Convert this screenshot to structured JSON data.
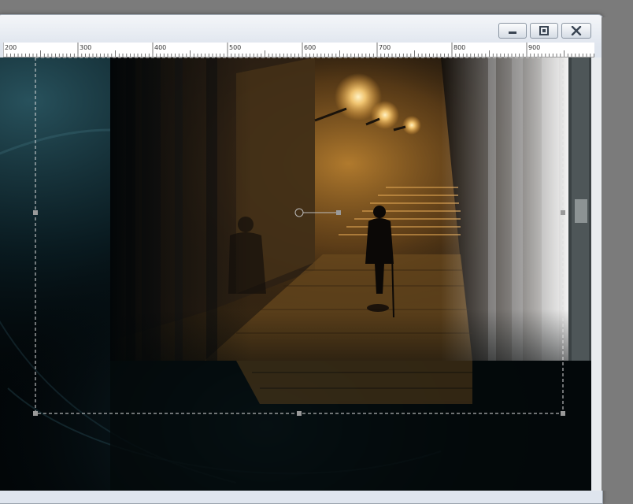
{
  "window": {
    "buttons": {
      "minimize": "minimize-icon",
      "maximize": "maximize-icon",
      "close": "close-icon"
    }
  },
  "ruler": {
    "labels": [
      "200",
      "300",
      "400",
      "500",
      "600",
      "700",
      "800",
      "900"
    ]
  },
  "colors": {
    "background": "#7b7b7b",
    "canvas": "#020608",
    "lamp_glow": "#ffd27a",
    "teal_swirl": "#2c5a66",
    "selection": "#dddddd"
  }
}
